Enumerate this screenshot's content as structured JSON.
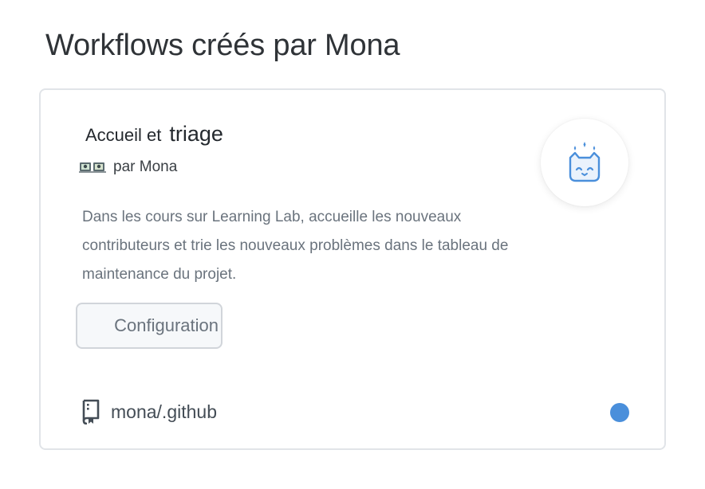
{
  "page": {
    "title": "Workflows créés par Mona"
  },
  "workflow": {
    "title_part1": "Accueil et",
    "title_part2": "triage",
    "author": "par Mona",
    "description": "Dans les cours sur Learning Lab, accueille les nouveaux contributeurs et trie les nouveaux problèmes dans le tableau de maintenance du projet.",
    "setup_button_label": "Configuration",
    "icon": "octocat-welcome-icon",
    "repo_icon": "repo-icon",
    "repository": "mona/.github",
    "language_color": "#4a8fdb",
    "accent_color": "#4a8fdb"
  }
}
